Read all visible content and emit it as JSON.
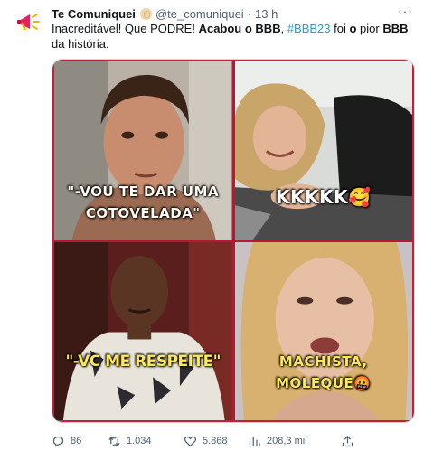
{
  "tweet": {
    "display_name": "Te Comuniquei",
    "handle": "@te_comuniquei",
    "separator": "·",
    "time": "13 h",
    "more_label": "···",
    "text_parts": {
      "p1": "Inacreditável! Que PODRE! ",
      "p2": "Acabou o BBB",
      "p3": ", ",
      "hashtag": "#BBB23",
      "p4": " foi ",
      "p5": "o",
      "p6": " pior ",
      "p7": "BBB",
      "p8": " da história."
    }
  },
  "media": {
    "panels": [
      {
        "caption_line1": "\"-VOU TE DAR UMA",
        "caption_line2": "COTOVELADA\""
      },
      {
        "caption": "KKKKK🥰"
      },
      {
        "caption": "\"-VC ME RESPEITE\""
      },
      {
        "caption_line1": "MACHISTA,",
        "caption_line2": "MOLEQUE🤬"
      }
    ]
  },
  "actions": {
    "replies": "86",
    "retweets": "1.034",
    "likes": "5.868",
    "views": "208,3 mil"
  },
  "colors": {
    "accent": "#1d9bf0",
    "frame": "#c0203a",
    "secondary_text": "#536471"
  },
  "icons": {
    "avatar": "megaphone-icon",
    "verified": "verified-badge-icon",
    "reply": "reply-icon",
    "retweet": "retweet-icon",
    "like": "heart-icon",
    "views": "views-icon",
    "share": "share-icon"
  }
}
